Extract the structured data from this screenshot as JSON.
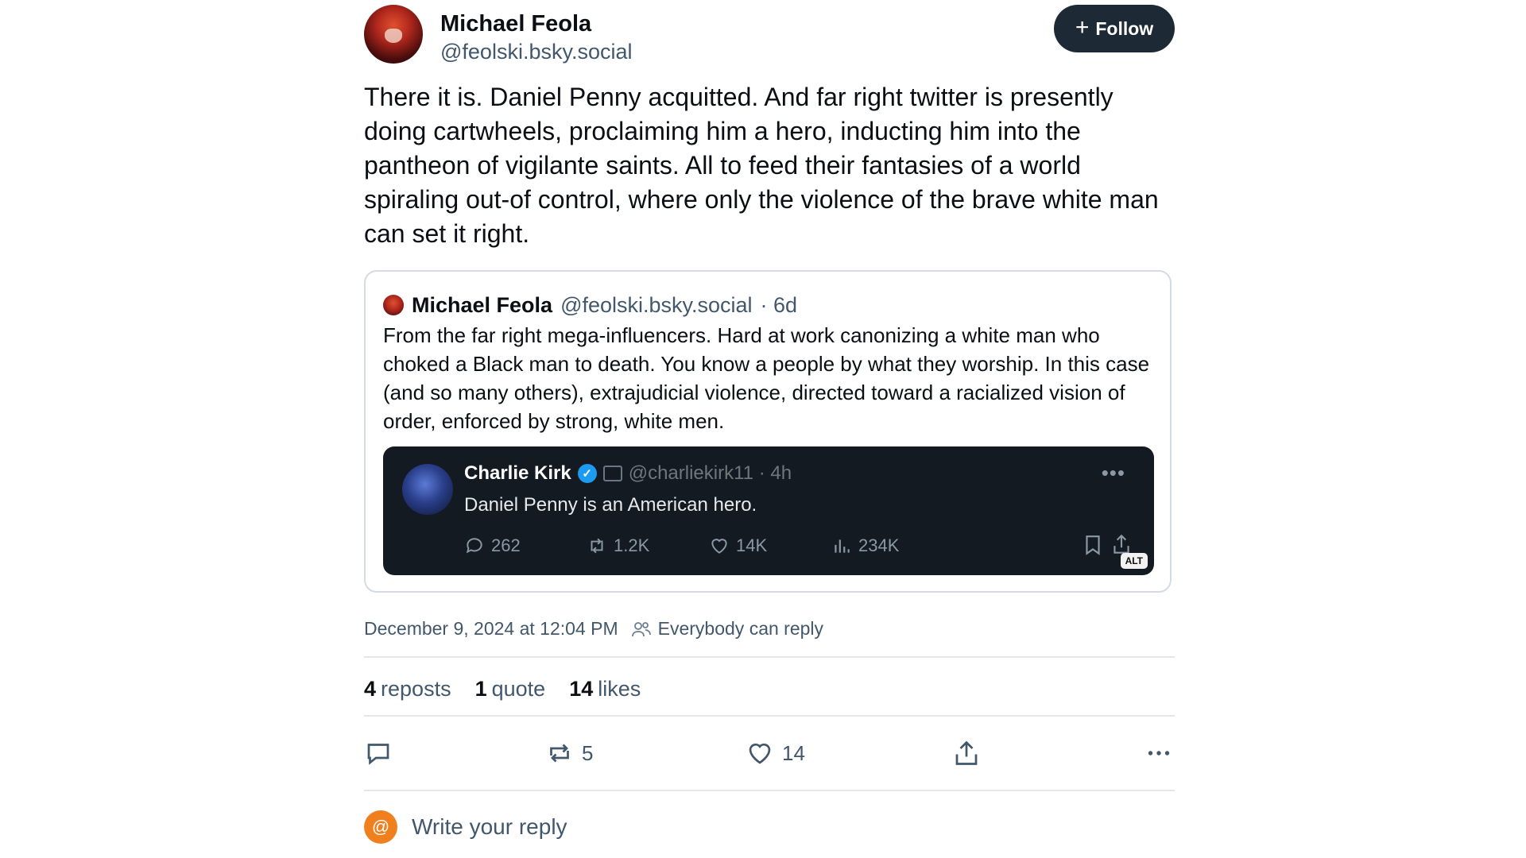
{
  "post": {
    "author_name": "Michael Feola",
    "author_handle": "@feolski.bsky.social",
    "follow_label": "Follow",
    "body": "There it is. Daniel Penny acquitted. And far right twitter is presently doing cartwheels, proclaiming him a hero, inducting him into the pantheon of vigilante saints. All to feed their fantasies of a world spiraling out-of control, where only the violence of the brave white man can set it right."
  },
  "quote": {
    "author_name": "Michael Feola",
    "author_handle": "@feolski.bsky.social",
    "age": "· 6d",
    "body": "From the far right mega-influencers. Hard at work canonizing a white man who choked a Black man to death. You know a people by what they worship. In this case (and so many others), extrajudicial violence, directed toward a racialized vision of order, enforced by strong, white men.",
    "embed": {
      "name": "Charlie Kirk",
      "handle": "@charliekirk11 · 4h",
      "text": "Daniel Penny is an American hero.",
      "replies": "262",
      "reposts": "1.2K",
      "likes": "14K",
      "views": "234K",
      "alt_badge": "ALT"
    }
  },
  "meta": {
    "timestamp": "December 9, 2024 at 12:04 PM",
    "reply_setting": "Everybody can reply"
  },
  "stats": {
    "reposts_count": "4",
    "reposts_label": "reposts",
    "quotes_count": "1",
    "quotes_label": "quote",
    "likes_count": "14",
    "likes_label": "likes"
  },
  "actions": {
    "repost_count": "5",
    "like_count": "14"
  },
  "reply": {
    "avatar_glyph": "@",
    "placeholder": "Write your reply"
  }
}
